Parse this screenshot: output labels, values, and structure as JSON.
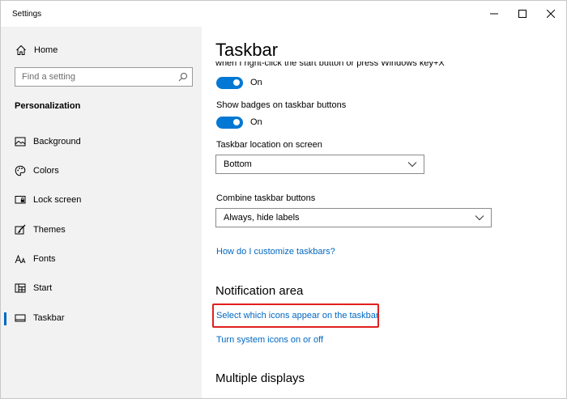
{
  "window": {
    "title": "Settings"
  },
  "sidebar": {
    "home_label": "Home",
    "search_placeholder": "Find a setting",
    "section_title": "Personalization",
    "items": [
      {
        "label": "Background",
        "icon": "image-icon"
      },
      {
        "label": "Colors",
        "icon": "palette-icon"
      },
      {
        "label": "Lock screen",
        "icon": "lock-screen-icon"
      },
      {
        "label": "Themes",
        "icon": "brush-icon"
      },
      {
        "label": "Fonts",
        "icon": "font-icon"
      },
      {
        "label": "Start",
        "icon": "start-grid-icon"
      },
      {
        "label": "Taskbar",
        "icon": "taskbar-icon",
        "active": true
      }
    ]
  },
  "main": {
    "title": "Taskbar",
    "cut_text": "when I right-click the start button or press Windows key+X",
    "toggle1_state": "On",
    "badges_label": "Show badges on taskbar buttons",
    "toggle2_state": "On",
    "location_label": "Taskbar location on screen",
    "location_value": "Bottom",
    "combine_label": "Combine taskbar buttons",
    "combine_value": "Always, hide labels",
    "customize_link": "How do I customize taskbars?",
    "notification_heading": "Notification area",
    "select_icons_link": "Select which icons appear on the taskbar",
    "system_icons_link": "Turn system icons on or off",
    "multiple_displays_heading": "Multiple displays"
  },
  "colors": {
    "accent": "#0078d4",
    "link": "#0067c0",
    "highlight": "#e0201e",
    "sidebar_bg": "#f2f2f2"
  }
}
